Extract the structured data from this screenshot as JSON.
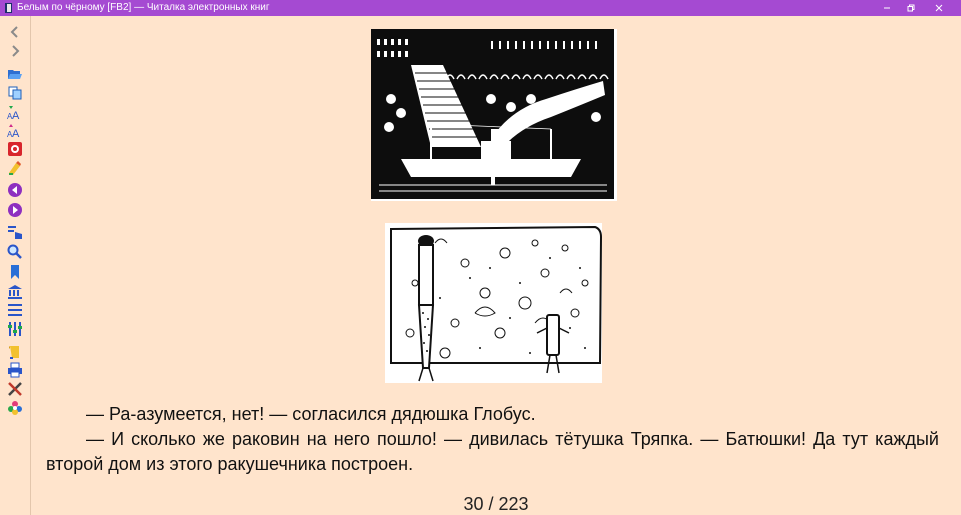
{
  "window": {
    "title": "Белым по чёрному [FB2] — Читалка электронных книг",
    "minimize_icon": "minimize-icon",
    "restore_icon": "restore-icon",
    "close_icon": "close-icon",
    "titlebar_color": "#a54ad2"
  },
  "toolbar": {
    "buttons": [
      {
        "name": "back-icon"
      },
      {
        "name": "forward-icon"
      },
      {
        "name": "open-file-icon"
      },
      {
        "name": "copy-icon"
      },
      {
        "name": "font-increase-icon"
      },
      {
        "name": "font-decrease-icon"
      },
      {
        "name": "help-icon"
      },
      {
        "name": "bookmark-add-icon"
      },
      {
        "name": "prev-page-icon"
      },
      {
        "name": "next-page-icon"
      },
      {
        "name": "go-to-icon"
      },
      {
        "name": "search-icon"
      },
      {
        "name": "bookmarks-icon"
      },
      {
        "name": "library-icon"
      },
      {
        "name": "contents-icon"
      },
      {
        "name": "settings-icon"
      },
      {
        "name": "scroll-icon"
      },
      {
        "name": "print-icon"
      },
      {
        "name": "tools-icon"
      },
      {
        "name": "theme-icon"
      }
    ]
  },
  "page": {
    "background": "#ffe4cc",
    "paragraphs": [
      "— Ра-азумеется, нет! — согласился дядюшка Глобус.",
      "— И сколько же раковин на него пошло! — дивилась тётушка Тряпка. — Батюшки! Да тут каждый второй дом из этого ракушечника построен."
    ],
    "page_indicator": "30 / 223"
  }
}
